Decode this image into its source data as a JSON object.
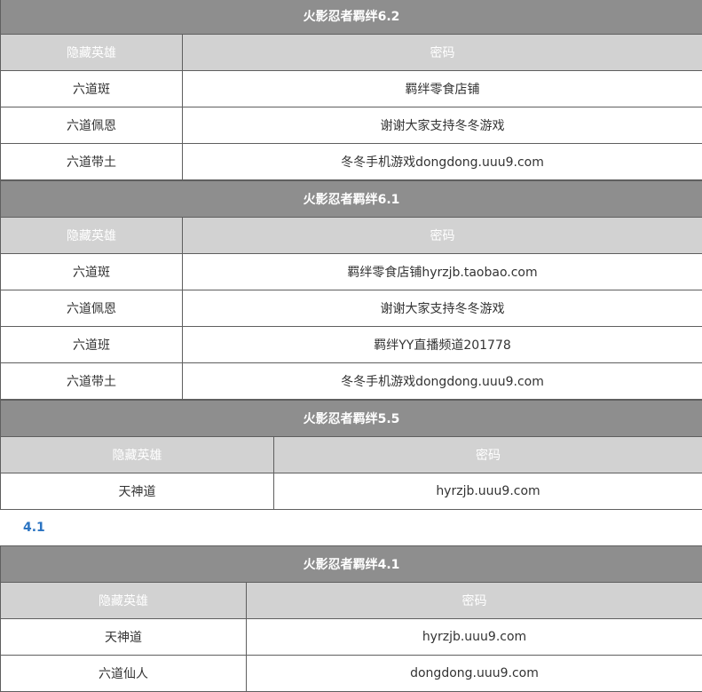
{
  "tables": [
    {
      "title": "火影忍者羁绊6.2",
      "headers": {
        "hero": "隐藏英雄",
        "password": "密码"
      },
      "rows": [
        {
          "hero": "六道斑",
          "password": "羁绊零食店铺"
        },
        {
          "hero": "六道佩恩",
          "password": "谢谢大家支持冬冬游戏"
        },
        {
          "hero": "六道带土",
          "password": "冬冬手机游戏dongdong.uuu9.com"
        }
      ]
    },
    {
      "title": "火影忍者羁绊6.1",
      "headers": {
        "hero": "隐藏英雄",
        "password": "密码"
      },
      "rows": [
        {
          "hero": "六道斑",
          "password": "羁绊零食店铺hyrzjb.taobao.com"
        },
        {
          "hero": "六道佩恩",
          "password": "谢谢大家支持冬冬游戏"
        },
        {
          "hero": "六道班",
          "password": "羁绊YY直播频道201778"
        },
        {
          "hero": "六道带土",
          "password": "冬冬手机游戏dongdong.uuu9.com"
        }
      ]
    },
    {
      "title": "火影忍者羁绊5.5",
      "headers": {
        "hero": "隐藏英雄",
        "password": "密码"
      },
      "rows": [
        {
          "hero": "天神道",
          "password": "hyrzjb.uuu9.com"
        }
      ]
    },
    {
      "title": "火影忍者羁绊4.1",
      "headers": {
        "hero": "隐藏英雄",
        "password": "密码"
      },
      "rows": [
        {
          "hero": "天神道",
          "password": "hyrzjb.uuu9.com"
        },
        {
          "hero": "六道仙人",
          "password": "dongdong.uuu9.com"
        }
      ]
    }
  ],
  "version_link": "4.1"
}
